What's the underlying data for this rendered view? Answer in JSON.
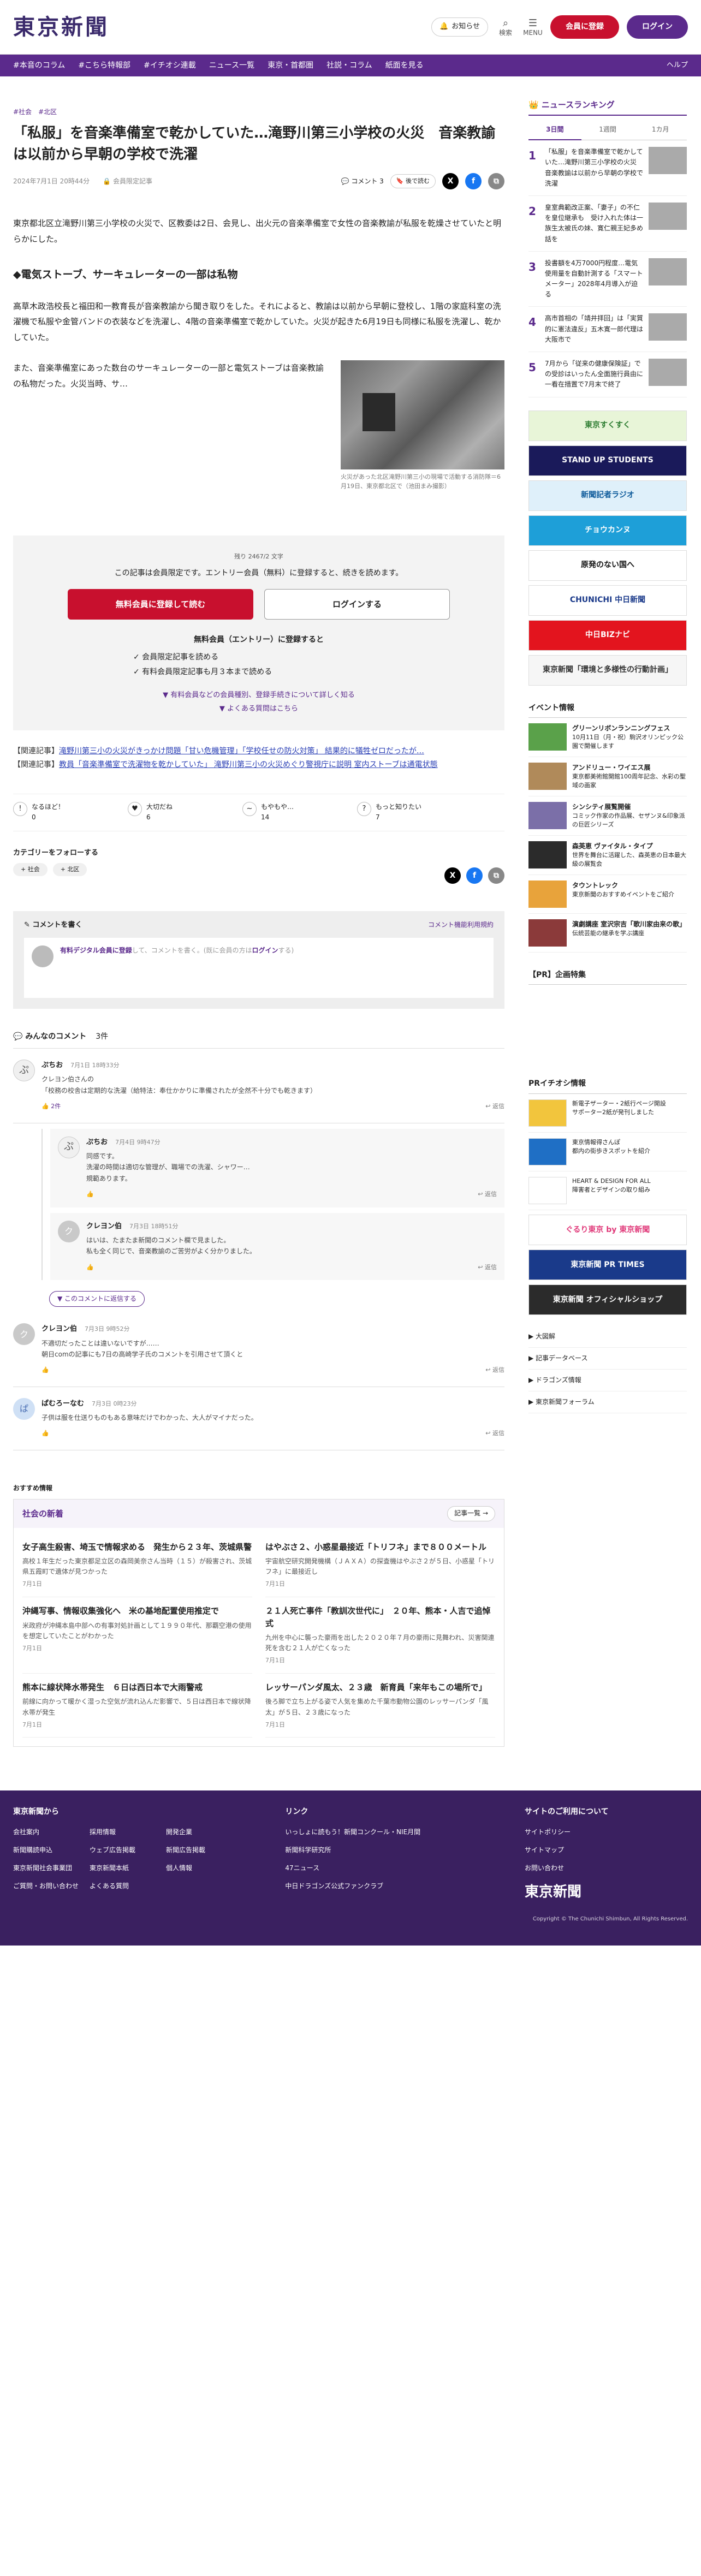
{
  "header": {
    "logo": "東京新聞",
    "notice": "お知らせ",
    "search": "検索",
    "menu": "MENU",
    "register": "会員に登録",
    "login": "ログイン"
  },
  "nav": {
    "items": [
      "#本音のコラム",
      "#こちら特報部",
      "#イチオシ連載",
      "ニュース一覧",
      "東京・首都圏",
      "社説・コラム",
      "紙面を見る"
    ],
    "right": "ヘルプ"
  },
  "article": {
    "breadcrumb": [
      "#社会",
      "#北区"
    ],
    "title": "「私服」を音楽準備室で乾かしていた…滝野川第三小学校の火災　音楽教諭は以前から早朝の学校で洗濯",
    "date": "2024年7月1日 20時44分",
    "member_label": "会員限定記事",
    "comment_label": "コメント",
    "comment_count": "3",
    "save_label": "後で読む",
    "lead": "東京都北区立滝野川第三小学校の火災で、区教委は2日、会見し、出火元の音楽準備室で女性の音楽教諭が私服を乾燥させていたと明らかにした。",
    "subhead": "◆電気ストーブ、サーキュレーターの一部は私物",
    "para1": "高草木政浩校長と福田和一教育長が音楽教諭から聞き取りをした。それによると、教諭は以前から早朝に登校し、1階の家庭科室の洗濯機で私服や金管バンドの衣装などを洗濯し、4階の音楽準備室で乾かしていた。火災が起きた6月19日も同様に私服を洗濯し、乾かしていた。",
    "para2": "また、音楽準備室にあった数台のサーキュレーターの一部と電気ストーブは音楽教諭の私物だった。火災当時、サ…",
    "photo_caption": "火災があった北区滝野川第三小の現場で活動する消防隊＝6月19日、東京都北区で（池田まみ撮影）"
  },
  "paywall": {
    "remaining": "残り 2467/2 文字",
    "message": "この記事は会員限定です。エントリー会員（無料）に登録すると、続きを読めます。",
    "register_btn": "無料会員に登録して読む",
    "login_btn": "ログインする",
    "benefit_title": "無料会員（エントリー）に登録すると",
    "benefits": [
      "✓ 会員限定記事を読める",
      "✓ 有料会員限定記事も月３本まで読める"
    ],
    "link1": "▼ 有料会員などの会員種別、登録手続きについて詳しく知る",
    "link2": "▼ よくある質問はこちら"
  },
  "related": [
    {
      "tag": "【関連記事】",
      "text": "滝野川第三小の火災がきっかけ問題「甘い危機管理」「学校任せの防火対策」 結果的に犠牲ゼロだったが…"
    },
    {
      "tag": "【関連記事】",
      "text": "教員「音楽準備室で洗濯物を乾かしていた」 滝野川第三小の火災めぐり警視庁に説明 室内ストーブは通電状態"
    }
  ],
  "reactions": [
    {
      "label": "なるほど！",
      "count": "0",
      "glyph": "!"
    },
    {
      "label": "大切だね",
      "count": "6",
      "glyph": "♥"
    },
    {
      "label": "もやもや…",
      "count": "14",
      "glyph": "~"
    },
    {
      "label": "もっと知りたい",
      "count": "7",
      "glyph": "?"
    }
  ],
  "follow": {
    "title": "カテゴリーをフォローする",
    "tags": [
      "+ 社会",
      "+ 北区"
    ]
  },
  "comment_box": {
    "title": "コメントを書く",
    "policy": "コメント機能利用規約",
    "link": "有料デジタル会員に登録",
    "text": "して、コメントを書く。(既に会員の方は",
    "login": "ログイン",
    "end": "する)"
  },
  "comments_section": {
    "title": "みんなのコメント",
    "count": "3件"
  },
  "comments": [
    {
      "name": "ぷちお",
      "time": "7月1日 18時33分",
      "text": "クレヨン伯さんの\n「校務の校舎は定期的な洗濯（給特法：奉仕かかりに準備されたが全然不十分でも乾きます）",
      "likes": "2件",
      "reply": "返信",
      "av": "rabbit",
      "avg": "ぷ"
    },
    {
      "name": "ぷちお",
      "time": "7月4日 9時47分",
      "text": "同感です。\n洗濯の時間は適切な管理が、職場での洗濯、シャワー…\n規範あります。",
      "likes": "",
      "reply": "返信",
      "av": "rabbit",
      "avg": "ぷ"
    },
    {
      "name": "クレヨン伯",
      "time": "7月3日 18時51分",
      "text": "はいは、たまたま新聞のコメント欄で見ました。\n私も全く同じで、音楽教諭のご苦労がよく分かりました。",
      "likes": "",
      "reply": "返信",
      "av": "gray",
      "avg": "ク"
    },
    {
      "name": "クレヨン伯",
      "time": "7月3日 9時52分",
      "text": "不適切だったことは違いないですが……\n朝日comの記事にも7日の高崎学子氏のコメントを引用させて頂くと",
      "likes": "",
      "reply": "返信",
      "av": "gray",
      "avg": "ク"
    },
    {
      "name": "ぱむろーなむ",
      "time": "7月3日 0時23分",
      "text": "子供は服を仕送りものもある意味だけでわかった、大人がマイナだった。",
      "likes": "",
      "reply": "返信",
      "av": "blue",
      "avg": "ぱ"
    }
  ],
  "more_replies": "▼ このコメントに返信する",
  "recommend": {
    "label": "おすすめ情報",
    "section": "社会の新着",
    "all": "記事一覧",
    "items": [
      {
        "title": "女子高生殺害、埼玉で情報求める　発生から２３年、茨城県警",
        "desc": "高校１年生だった東京都足立区の森岡美奈さん当時（１５）が殺害され、茨城県五霞町で遺体が見つかった",
        "time": "7月1日"
      },
      {
        "title": "はやぶさ２、小惑星最接近「トリフネ」まで８００メートル",
        "desc": "宇宙航空研究開発機構（ＪＡＸＡ）の探査機はやぶさ２が５日、小惑星「トリフネ」に最接近し",
        "time": "7月1日"
      },
      {
        "title": "沖縄写事、情報収集強化へ　米の基地配置使用推定で",
        "desc": "米政府が沖縄本島中部への有事対処計画として１９９０年代、那覇空港の使用を想定していたことがわかった",
        "time": "7月1日"
      },
      {
        "title": "２１人死亡事件「教訓次世代に」　２０年、熊本・人吉で追悼式",
        "desc": "九州を中心に襲った豪雨を出した２０２０年７月の豪雨に見舞われ、災害関連死を含む２１人が亡くなった",
        "time": "7月1日"
      },
      {
        "title": "熊本に線状降水帯発生　６日は西日本で大雨警戒",
        "desc": "前線に向かって暖かく湿った空気が流れ込んだ影響で、５日は西日本で線状降水帯が発生",
        "time": "7月1日"
      },
      {
        "title": "レッサーパンダ風太、２３歳　新育員「来年もこの場所で」",
        "desc": "後ろ脚で立ち上がる姿で人気を集めた千葉市動物公園のレッサーパンダ「風太」が５日、２３歳になった",
        "time": "7月1日"
      }
    ]
  },
  "sidebar": {
    "ranking_title": "ニュースランキング",
    "tabs": [
      "3日間",
      "1週間",
      "1カ月"
    ],
    "ranking": [
      {
        "num": "1",
        "text": "「私服」を音楽準備室で乾かしていた…滝野川第三小学校の火災　音楽教諭は以前から早朝の学校で洗濯"
      },
      {
        "num": "2",
        "text": "皇室典範改正案、「妻子」の不仁を皇位継承も　受け入れた体は一族生太被氏の妹、寛仁親王妃多め話を"
      },
      {
        "num": "3",
        "text": "投書額を4万7000円程度…電気使用量を自動計測する「スマートメーター」2028年4月導入が迫る"
      },
      {
        "num": "4",
        "text": "高市首相の「靖井拝回」は「実質的に憲法違反」五木寛一郎代理は大阪市で"
      },
      {
        "num": "5",
        "text": "7月から「従来の健康保険証」での受診はいったん全面施行員由に一看在措置で7月末で終了"
      }
    ],
    "banners": [
      {
        "text": "東京すくすく",
        "bg": "#e8f5d8",
        "fg": "#2e7d32"
      },
      {
        "text": "STAND UP STUDENTS",
        "bg": "#1a1a5a",
        "fg": "#ffffff"
      },
      {
        "text": "新聞記者ラジオ",
        "bg": "#dff0fa",
        "fg": "#0d5a9a"
      },
      {
        "text": "チョウカンヌ",
        "bg": "#1e9fd8",
        "fg": "#ffffff"
      },
      {
        "text": "原発のない国へ",
        "bg": "#ffffff",
        "fg": "#111111"
      },
      {
        "text": "CHUNICHI 中日新聞",
        "bg": "#ffffff",
        "fg": "#1b3a8a"
      },
      {
        "text": "中日BIZナビ",
        "bg": "#e3141e",
        "fg": "#ffffff"
      },
      {
        "text": "東京新聞「環境と多様性の行動計画」",
        "bg": "#f6f6f6",
        "fg": "#333333"
      }
    ],
    "events_title": "イベント情報",
    "events": [
      {
        "title": "グリーンリボンランニングフェス",
        "desc": "10月11日（月・祝）駒沢オリンピック公園で開催します",
        "color": "#5aa14a"
      },
      {
        "title": "アンドリュー・ワイエス展",
        "desc": "東京都美術館開館100周年記念、水彩の聖域の画家",
        "color": "#b08a5a"
      },
      {
        "title": "シンシティ展覧開催",
        "desc": "コミック作家の作品展、セザンヌ&印象派の巨匠シリーズ",
        "color": "#7b6fa8"
      },
      {
        "title": "森英恵 ヴァイタル・タイプ",
        "desc": "世界を舞台に活躍した、森英恵の日本最大級の展覧会",
        "color": "#2b2b2b"
      },
      {
        "title": "タウントレック",
        "desc": "東京新聞のおすすめイベントをご紹介",
        "color": "#e8a33b"
      },
      {
        "title": "演劇講座 室沢宗吉「歌川家由来の歌」",
        "desc": "伝統芸能の継承を学ぶ講座",
        "color": "#8b3a3a"
      }
    ],
    "pr_title": "【PR】企画特集",
    "pr_ichioshi": "PRイチオシ情報",
    "pr_items": [
      {
        "title": "新電子ザーター・2紙行ページ開設",
        "desc": "サポーター2紙が発刊しました",
        "color": "#f2c53d"
      },
      {
        "title": "東京情報得さんぽ",
        "desc": "都内の街歩きスポットを紹介",
        "color": "#1f6fc5"
      },
      {
        "title": "HEART & DESIGN FOR ALL",
        "desc": "障害者とデザインの取り組み",
        "color": "#ffffff"
      }
    ],
    "pr_banners": [
      {
        "text": "ぐるり東京 by 東京新聞",
        "bg": "#ffffff",
        "fg": "#e03a7a"
      },
      {
        "text": "東京新聞 PR TIMES",
        "bg": "#1a3a8a",
        "fg": "#ffffff"
      },
      {
        "text": "東京新聞 オフィシャルショップ",
        "bg": "#2b2b2b",
        "fg": "#ffffff"
      }
    ],
    "links": [
      "▶ 大図解",
      "▶ 記事データベース",
      "▶ ドラゴンズ情報",
      "▶ 東京新聞フォーラム"
    ]
  },
  "footer": {
    "col1_title": "東京新聞から",
    "col1": [
      "会社案内",
      "採用情報",
      "開発企業",
      "新聞購読申込",
      "ウェブ広告掲載",
      "新聞広告掲載",
      "東京新聞社会事業団",
      "東京新聞本紙",
      "個人情報",
      "ご質問・お問い合わせ",
      "よくある質問"
    ],
    "col2_title": "リンク",
    "col2": [
      "いっしょに読もう！新聞コンクール・NIE月間",
      "新聞科学研究所",
      "47ニュース",
      "中日ドラゴンズ公式ファンクラブ"
    ],
    "col3_title": "サイトのご利用について",
    "col3": [
      "サイトポリシー",
      "サイトマップ",
      "お問い合わせ"
    ],
    "logo": "東京新聞",
    "copyright": "Copyright © The Chunichi Shimbun, All Rights Reserved."
  },
  "colors": {
    "brand": "#5b2a8c",
    "accent_red": "#c8102e",
    "footer": "#3a2060"
  }
}
